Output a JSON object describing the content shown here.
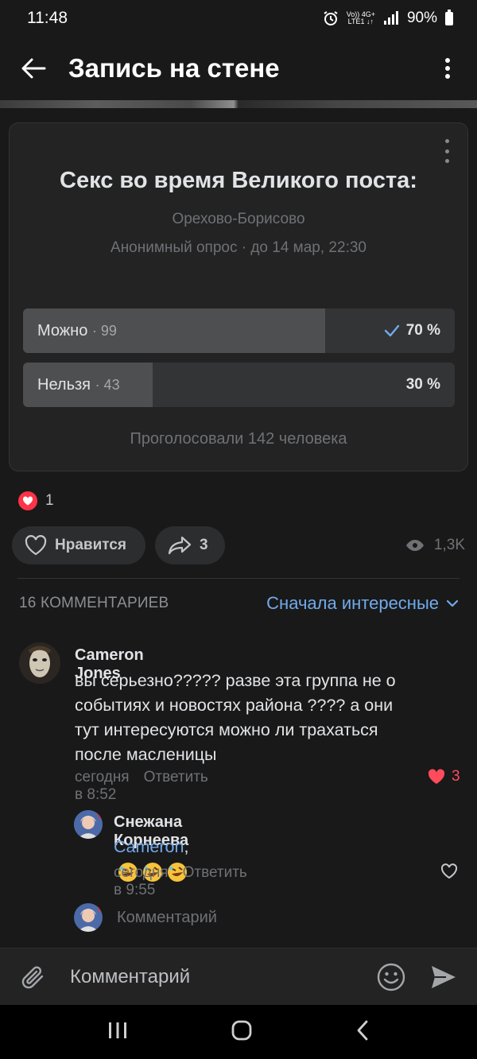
{
  "status": {
    "time": "11:48",
    "network_top": "Vo)) 4G+",
    "network_bottom": "LTE1 ↓↑",
    "battery": "90%"
  },
  "appbar": {
    "title": "Запись на стене"
  },
  "poll": {
    "title": "Секс во время Великого поста:",
    "group": "Орехово-Борисово",
    "meta": "Анонимный опрос · до 14 мар, 22:30",
    "options": [
      {
        "label": "Можно",
        "count": "· 99",
        "percent": "70 %",
        "share": 0.7,
        "voted": true
      },
      {
        "label": "Нельзя",
        "count": "· 43",
        "percent": "30 %",
        "share": 0.3,
        "voted": false
      }
    ],
    "total": "Проголосовали 142 человека"
  },
  "reactions": {
    "count": "1"
  },
  "actions": {
    "like_label": "Нравится",
    "share_count": "3",
    "views": "1,3K"
  },
  "comments": {
    "count_label": "16 КОММЕНТАРИЕВ",
    "sort_label": "Сначала интересные",
    "items": [
      {
        "author": "Cameron Jones",
        "text_lines": [
          "вы серьезно????? разве эта группа не о",
          "событиях и новостях района ???? а они",
          "тут интересуются можно ли трахаться",
          "после масленицы"
        ],
        "time": "сегодня в 8:52",
        "reply": "Ответить",
        "likes": "3"
      },
      {
        "author": "Снежана Корнеева",
        "mention": "Cameron",
        "after_mention": ",",
        "time": "сегодня в 9:55",
        "reply": "Ответить"
      }
    ],
    "reply_placeholder": "Комментарий"
  },
  "composer": {
    "placeholder": "Комментарий"
  },
  "colors": {
    "accent": "#71aaeb",
    "like": "#ff3347",
    "background": "#191919",
    "card": "#232323"
  }
}
